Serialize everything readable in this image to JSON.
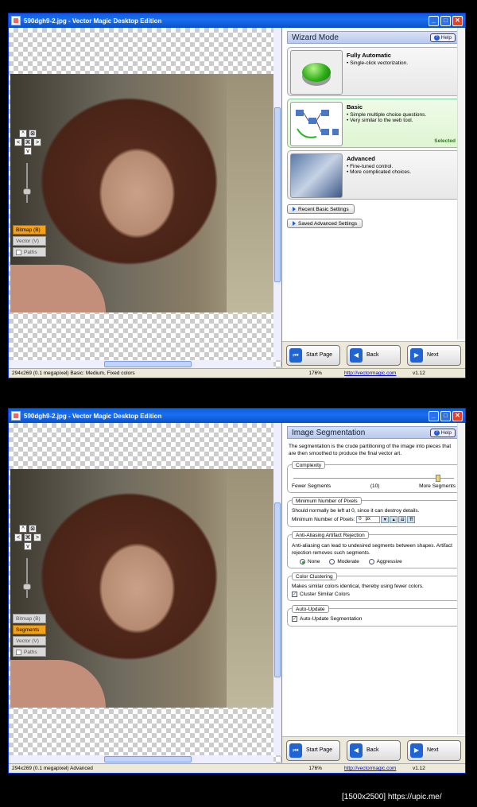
{
  "screen1": {
    "title": "590dgh9-2.jpg - Vector Magic Desktop Edition",
    "panel_title": "Wizard Mode",
    "help_label": "Help",
    "modes": [
      "Bitmap (B)",
      "Vector (V)",
      "Paths"
    ],
    "cards": [
      {
        "title": "Fully Automatic",
        "bullets": [
          "• Single-click vectorization."
        ],
        "selected": ""
      },
      {
        "title": "Basic",
        "bullets": [
          "• Simple multiple choice questions.",
          "• Very similar to the web tool."
        ],
        "selected": "Selected"
      },
      {
        "title": "Advanced",
        "bullets": [
          "• Fine-tuned control.",
          "• More complicated choices."
        ],
        "selected": ""
      }
    ],
    "recent_label": "Recent Basic Settings",
    "saved_label": "Saved Advanced Settings",
    "status": {
      "info": "294x269 (0.1 megapixel)  Basic: Medium, Fixed colors",
      "zoom": "176%",
      "link": "http://vectormagic.com",
      "version": "v1.12"
    }
  },
  "screen2": {
    "title": "590dgh9-2.jpg - Vector Magic Desktop Edition",
    "panel_title": "Image Segmentation",
    "help_label": "Help",
    "modes": [
      "Bitmap (B)",
      "Segments",
      "Vector (V)",
      "Paths"
    ],
    "intro": "The segmentation is the crude partitioning of the image into pieces that are then smoothed to produce the final vector art.",
    "complexity": {
      "title": "Complexity",
      "left": "Fewer Segments",
      "mid": "(10)",
      "right": "More Segments",
      "level": 0.9
    },
    "min_pixels": {
      "title": "Minimum Number of Pixels",
      "desc": "Should normally be left at 0, since it can destroy details.",
      "label": "Minimum Number of Pixels:",
      "value": "0",
      "unit": "px"
    },
    "antialias": {
      "title": "Anti-Aliasing Artifact Rejection",
      "desc": "Anti-aliasing can lead to undesired segments between shapes. Artifact rejection removes such segments.",
      "options": [
        "None",
        "Moderate",
        "Aggressive"
      ]
    },
    "clustering": {
      "title": "Color Clustering",
      "desc": "Makes similar colors identical, thereby using fewer colors.",
      "check": "Cluster Similar Colors"
    },
    "autoupdate": {
      "title": "Auto-Update",
      "check": "Auto-Update Segmentation"
    },
    "status": {
      "info": "294x269 (0.1 megapixel)  Advanced",
      "zoom": "176%",
      "link": "http://vectormagic.com",
      "version": "v1.12"
    }
  },
  "nav": {
    "start": "Start Page",
    "back": "Back",
    "next": "Next"
  },
  "footer": "[1500x2500] https://upic.me/"
}
